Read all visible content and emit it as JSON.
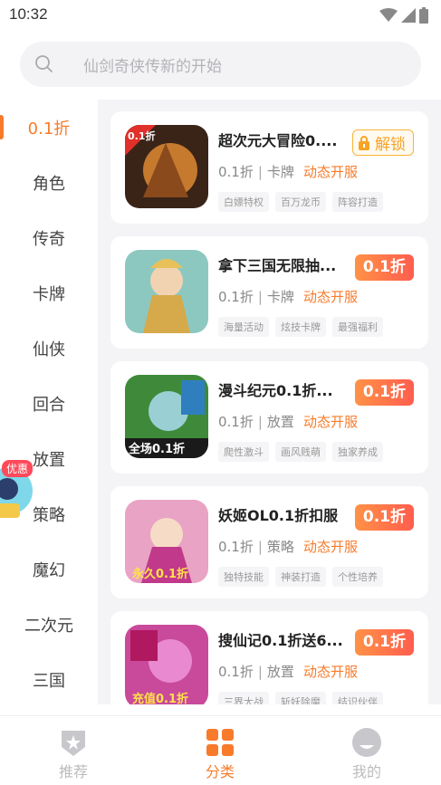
{
  "status_bar": {
    "time": "10:32"
  },
  "search": {
    "placeholder": "仙剑奇侠传新的开始"
  },
  "sidebar": {
    "items": [
      {
        "label": "0.1折",
        "active": true
      },
      {
        "label": "角色"
      },
      {
        "label": "传奇"
      },
      {
        "label": "卡牌"
      },
      {
        "label": "仙侠"
      },
      {
        "label": "回合"
      },
      {
        "label": "放置"
      },
      {
        "label": "策略"
      },
      {
        "label": "魔幻"
      },
      {
        "label": "二次元"
      },
      {
        "label": "三国"
      }
    ]
  },
  "promo": {
    "label": "优惠"
  },
  "games": [
    {
      "name": "超次元大冒险0....",
      "genre_a": "0.1折",
      "genre_b": "卡牌",
      "status": "动态开服",
      "tags": [
        "白嫖特权",
        "百万龙币",
        "阵容打造"
      ],
      "action": "解锁",
      "action_type": "unlock",
      "icon_text": "0.1折"
    },
    {
      "name": "拿下三国无限抽...",
      "genre_a": "0.1折",
      "genre_b": "卡牌",
      "status": "动态开服",
      "tags": [
        "海量活动",
        "炫技卡牌",
        "最强福利"
      ],
      "action": "0.1折",
      "action_type": "discount",
      "icon_text": ""
    },
    {
      "name": "漫斗纪元0.1折...",
      "genre_a": "0.1折",
      "genre_b": "放置",
      "status": "动态开服",
      "tags": [
        "爬性激斗",
        "画风贱萌",
        "独家养成"
      ],
      "action": "0.1折",
      "action_type": "discount",
      "icon_text": "全场0.1折"
    },
    {
      "name": "妖姬OL0.1折扣服",
      "genre_a": "0.1折",
      "genre_b": "策略",
      "status": "动态开服",
      "tags": [
        "独特技能",
        "神装打造",
        "个性培养"
      ],
      "action": "0.1折",
      "action_type": "discount",
      "icon_text": "永久0.1折"
    },
    {
      "name": "搜仙记0.1折送6...",
      "genre_a": "0.1折",
      "genre_b": "放置",
      "status": "动态开服",
      "tags": [
        "三界大战",
        "斩妖除魔",
        "结识伙伴"
      ],
      "action": "0.1折",
      "action_type": "discount",
      "icon_text": "充值0.1折"
    }
  ],
  "tabbar": {
    "tabs": [
      {
        "label": "推荐"
      },
      {
        "label": "分类",
        "active": true
      },
      {
        "label": "我的"
      }
    ]
  },
  "colors": {
    "accent": "#f77b2b",
    "badge_from": "#ff9247",
    "badge_to": "#ff5d4e",
    "unlock": "#f7a425"
  }
}
